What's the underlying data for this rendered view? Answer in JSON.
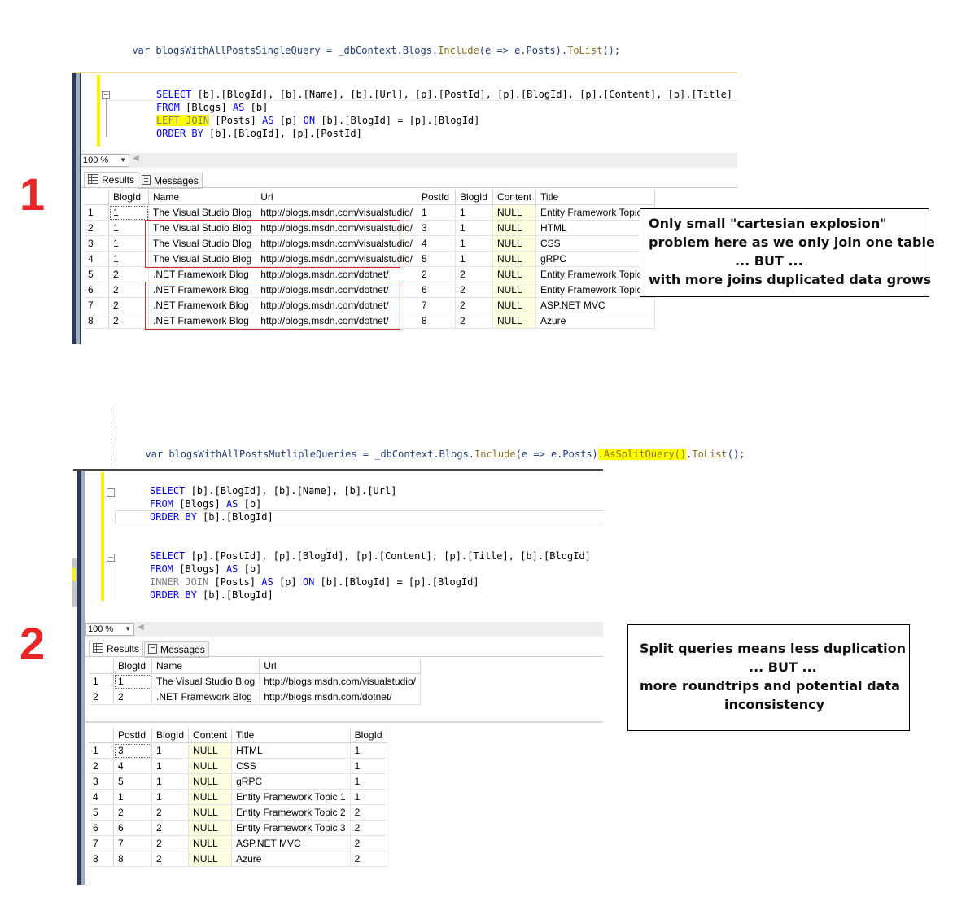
{
  "section1": {
    "number": "1",
    "csharp": {
      "prefix": "var blogsWithAllPostsSingleQuery = _dbContext.Blogs.",
      "include": "Include",
      "lambda": "(e => e.Posts).",
      "tolist": "ToList",
      "suffix": "();"
    },
    "sql": [
      {
        "kw1": "SELECT",
        "rest1": " [b].[BlogId], [b].[Name], [b].[Url], [p].[PostId], [p].[BlogId], [p].[Content], [p].[Title]"
      },
      {
        "kw1": "FROM",
        "rest1": " [Blogs] ",
        "kw2": "AS",
        "rest2": " [b]"
      },
      {
        "kw1": "LEFT JOIN",
        "rest1": " [Posts] ",
        "kw2": "AS",
        "rest2": " [p] ",
        "kw3": "ON",
        "rest3": " [b].[BlogId] = [p].[BlogId]"
      },
      {
        "kw1": "ORDER BY",
        "rest1": " [b].[BlogId], [p].[PostId]"
      }
    ],
    "zoom": "100 %",
    "tabs": {
      "results": "Results",
      "messages": "Messages"
    },
    "table": {
      "columns": [
        "BlogId",
        "Name",
        "Url",
        "PostId",
        "BlogId",
        "Content",
        "Title"
      ],
      "rows": [
        [
          "1",
          "1",
          "The Visual Studio Blog",
          "http://blogs.msdn.com/visualstudio/",
          "1",
          "1",
          "NULL",
          "Entity Framework Topic 1"
        ],
        [
          "2",
          "1",
          "The Visual Studio Blog",
          "http://blogs.msdn.com/visualstudio/",
          "3",
          "1",
          "NULL",
          "HTML"
        ],
        [
          "3",
          "1",
          "The Visual Studio Blog",
          "http://blogs.msdn.com/visualstudio/",
          "4",
          "1",
          "NULL",
          "CSS"
        ],
        [
          "4",
          "1",
          "The Visual Studio Blog",
          "http://blogs.msdn.com/visualstudio/",
          "5",
          "1",
          "NULL",
          "gRPC"
        ],
        [
          "5",
          "2",
          ".NET Framework Blog",
          "http://blogs.msdn.com/dotnet/",
          "2",
          "2",
          "NULL",
          "Entity Framework Topic 2"
        ],
        [
          "6",
          "2",
          ".NET Framework Blog",
          "http://blogs.msdn.com/dotnet/",
          "6",
          "2",
          "NULL",
          "Entity Framework Topic 3"
        ],
        [
          "7",
          "2",
          ".NET Framework Blog",
          "http://blogs.msdn.com/dotnet/",
          "7",
          "2",
          "NULL",
          "ASP.NET MVC"
        ],
        [
          "8",
          "2",
          ".NET Framework Blog",
          "http://blogs.msdn.com/dotnet/",
          "8",
          "2",
          "NULL",
          "Azure"
        ]
      ]
    },
    "note": [
      "Only small \"cartesian explosion\"",
      "problem here as we only join one table",
      "... BUT ...",
      "with more joins duplicated data grows"
    ]
  },
  "section2": {
    "number": "2",
    "csharp": {
      "prefix": "var blogsWithAllPostsMutlipleQueries = _dbContext.Blogs.",
      "include": "Include",
      "lambda": "(e => e.Posts)",
      "split": ".AsSplitQuery()",
      "tolist": "ToList",
      "suffix": "();"
    },
    "sql1": [
      {
        "kw1": "SELECT",
        "rest1": " [b].[BlogId], [b].[Name], [b].[Url]"
      },
      {
        "kw1": "FROM",
        "rest1": " [Blogs] ",
        "kw2": "AS",
        "rest2": " [b]"
      },
      {
        "kw1": "ORDER BY",
        "rest1": " [b].[BlogId]"
      }
    ],
    "sql2": [
      {
        "kw1": "SELECT",
        "rest1": " [p].[PostId], [p].[BlogId], [p].[Content], [p].[Title], [b].[BlogId]"
      },
      {
        "kw1": "FROM",
        "rest1": " [Blogs] ",
        "kw2": "AS",
        "rest2": " [b]"
      },
      {
        "kw1": "INNER JOIN",
        "rest1": " [Posts] ",
        "kw2": "AS",
        "rest2": " [p] ",
        "kw3": "ON",
        "rest3": " [b].[BlogId] = [p].[BlogId]"
      },
      {
        "kw1": "ORDER BY",
        "rest1": " [b].[BlogId]"
      }
    ],
    "zoom": "100 %",
    "tabs": {
      "results": "Results",
      "messages": "Messages"
    },
    "table1": {
      "columns": [
        "BlogId",
        "Name",
        "Url"
      ],
      "rows": [
        [
          "1",
          "1",
          "The Visual Studio Blog",
          "http://blogs.msdn.com/visualstudio/"
        ],
        [
          "2",
          "2",
          ".NET Framework Blog",
          "http://blogs.msdn.com/dotnet/"
        ]
      ]
    },
    "table2": {
      "columns": [
        "PostId",
        "BlogId",
        "Content",
        "Title",
        "BlogId"
      ],
      "rows": [
        [
          "1",
          "3",
          "1",
          "NULL",
          "HTML",
          "1"
        ],
        [
          "2",
          "4",
          "1",
          "NULL",
          "CSS",
          "1"
        ],
        [
          "3",
          "5",
          "1",
          "NULL",
          "gRPC",
          "1"
        ],
        [
          "4",
          "1",
          "1",
          "NULL",
          "Entity Framework Topic 1",
          "1"
        ],
        [
          "5",
          "2",
          "2",
          "NULL",
          "Entity Framework Topic 2",
          "2"
        ],
        [
          "6",
          "6",
          "2",
          "NULL",
          "Entity Framework Topic 3",
          "2"
        ],
        [
          "7",
          "7",
          "2",
          "NULL",
          "ASP.NET MVC",
          "2"
        ],
        [
          "8",
          "8",
          "2",
          "NULL",
          "Azure",
          "2"
        ]
      ]
    },
    "note": [
      "Split queries means less duplication",
      "... BUT ...",
      "more roundtrips and potential data",
      "inconsistency"
    ]
  }
}
